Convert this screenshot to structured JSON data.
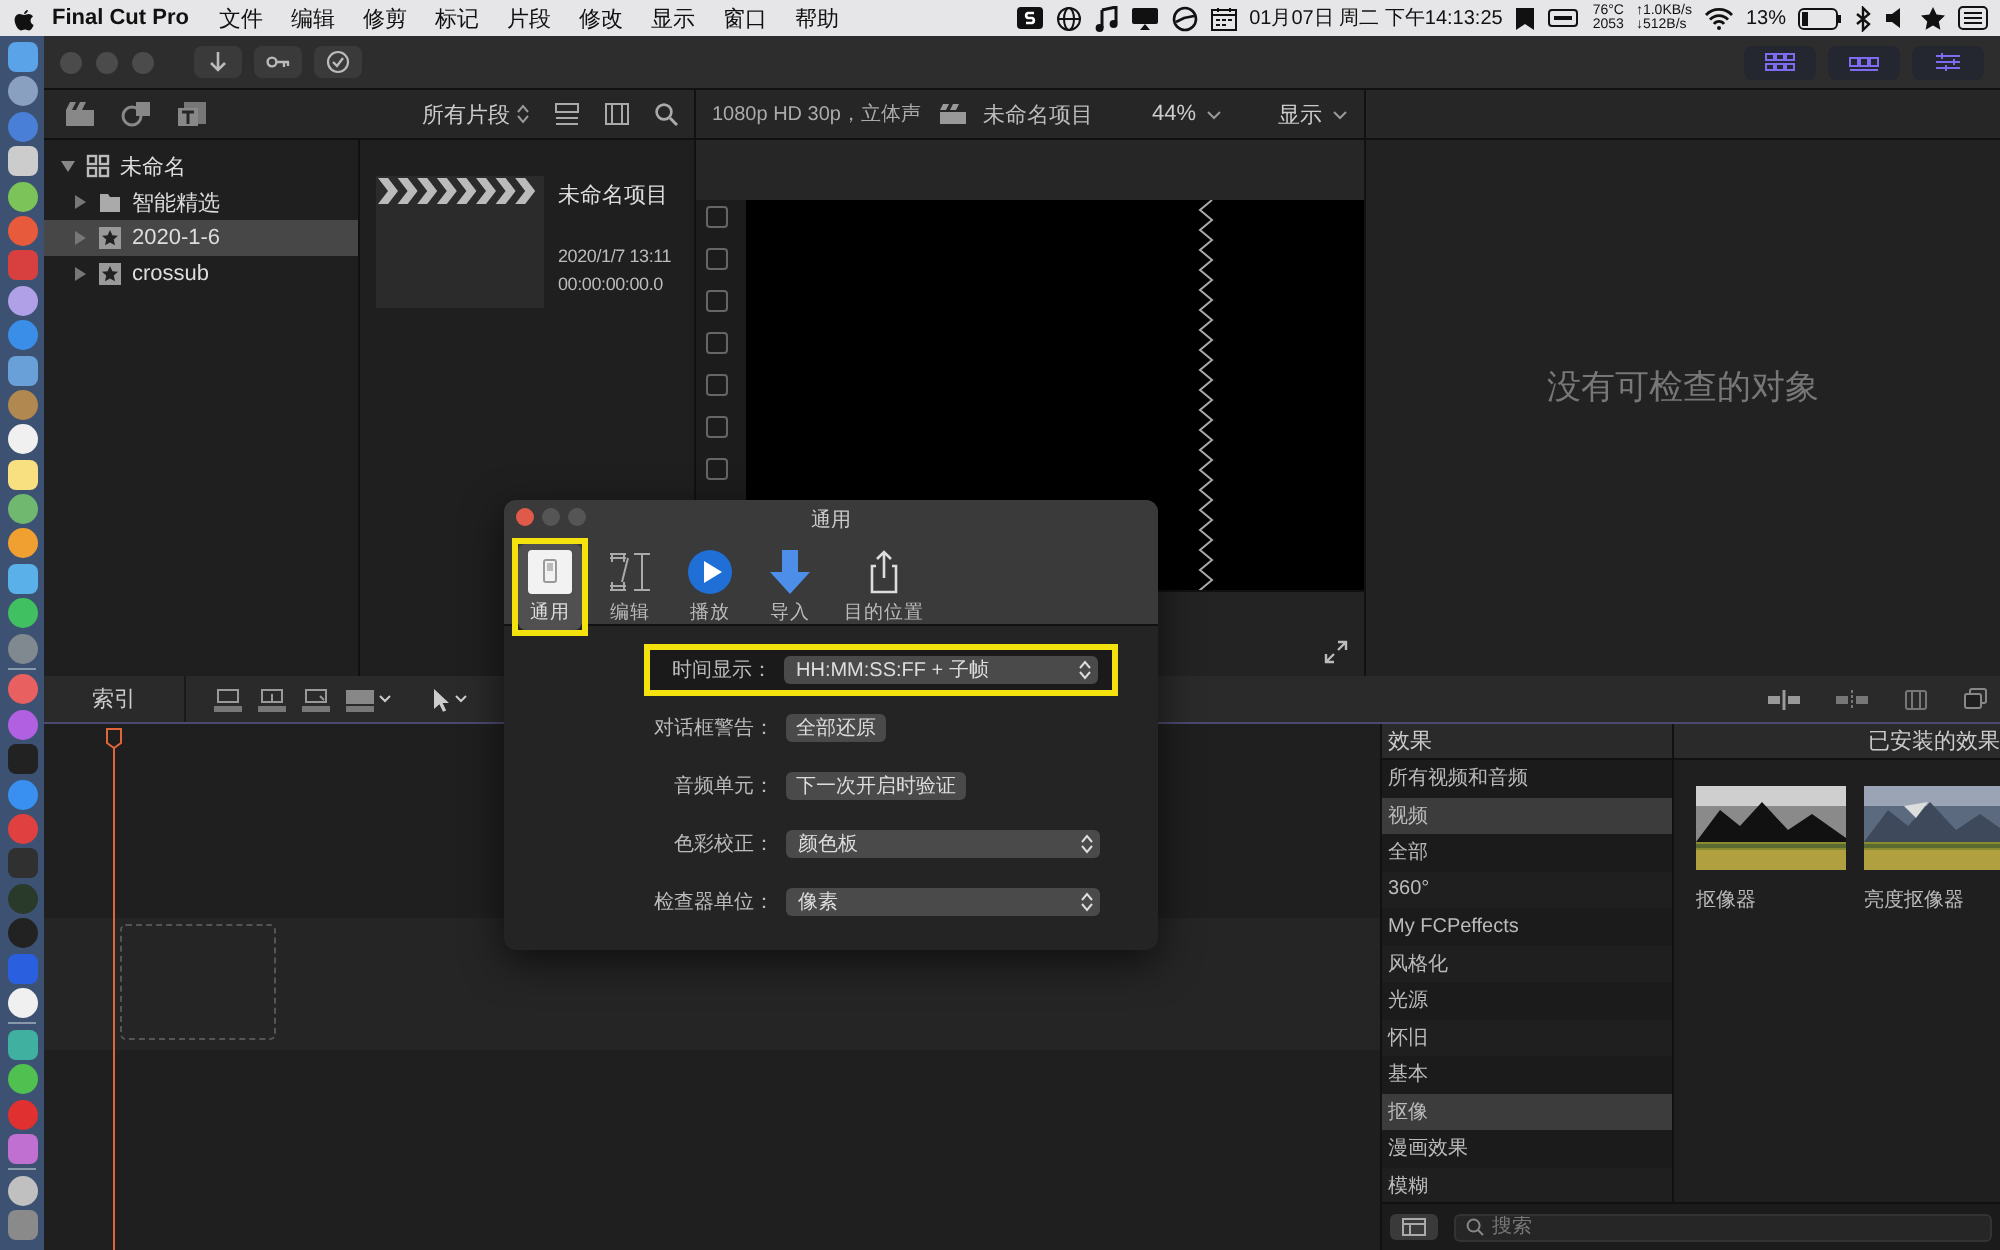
{
  "menu_bar": {
    "app": "Final Cut Pro",
    "menus": [
      "文件",
      "编辑",
      "修剪",
      "标记",
      "片段",
      "修改",
      "显示",
      "窗口",
      "帮助"
    ],
    "status": {
      "datetime": "01月07日 周二 下午14:13:25",
      "temperature": "76°C",
      "fan": "2053",
      "upload": "↑1.0KB/s",
      "download": "↓512B/s",
      "battery": "13%"
    }
  },
  "library": {
    "label": "未命名",
    "expanded": true,
    "children": [
      {
        "label": "智能精选",
        "kind": "folder",
        "expanded": false,
        "selected": false
      },
      {
        "label": "2020-1-6",
        "kind": "event",
        "expanded": false,
        "selected": true
      },
      {
        "label": "crossub",
        "kind": "event",
        "expanded": false,
        "selected": false
      }
    ]
  },
  "browser": {
    "filter": "所有片段",
    "clip": {
      "title": "未命名项目",
      "date": "2020/1/7 13:11",
      "duration": "00:00:00:00.0"
    }
  },
  "viewer": {
    "format": "1080p HD 30p，立体声",
    "project": "未命名项目",
    "zoom": "44%",
    "view_menu": "显示"
  },
  "inspector": {
    "message": "没有可检查的对象"
  },
  "timeline": {
    "index_button": "索引"
  },
  "effects": {
    "header": "效果",
    "categories": [
      {
        "label": "所有视频和音频",
        "selected": false
      },
      {
        "label": "视频",
        "selected": true
      },
      {
        "label": "全部",
        "selected": false
      },
      {
        "label": "360°",
        "selected": false
      },
      {
        "label": "My FCPeffects",
        "selected": false
      },
      {
        "label": "风格化",
        "selected": false
      },
      {
        "label": "光源",
        "selected": false
      },
      {
        "label": "怀旧",
        "selected": false
      },
      {
        "label": "基本",
        "selected": false
      },
      {
        "label": "抠像",
        "selected": true
      },
      {
        "label": "漫画效果",
        "selected": false
      },
      {
        "label": "模糊",
        "selected": false
      }
    ],
    "installed_title": "已安装的效果",
    "items": [
      {
        "label": "抠像器",
        "kind": "picture"
      },
      {
        "label": "亮度抠像器",
        "kind": "picture"
      }
    ],
    "search": {
      "placeholder": "搜索"
    }
  },
  "dialog": {
    "title": "通用",
    "tabs": [
      {
        "label": "通用",
        "kind": "general",
        "selected": true,
        "highlighted": true
      },
      {
        "label": "编辑",
        "kind": "editing",
        "selected": false,
        "highlighted": false
      },
      {
        "label": "播放",
        "kind": "playback",
        "selected": false,
        "highlighted": false
      },
      {
        "label": "导入",
        "kind": "import",
        "selected": false,
        "highlighted": false
      },
      {
        "label": "目的位置",
        "kind": "destinations",
        "selected": false,
        "highlighted": false
      }
    ],
    "rows": [
      {
        "label": "时间显示：",
        "kind": "popup",
        "value": "HH:MM:SS:FF + 子帧",
        "highlighted": true
      },
      {
        "label": "对话框警告：",
        "kind": "button",
        "value": "全部还原",
        "highlighted": false
      },
      {
        "label": "音频单元：",
        "kind": "button",
        "value": "下一次开启时验证",
        "highlighted": false
      },
      {
        "label": "色彩校正：",
        "kind": "popup",
        "value": "颜色板",
        "highlighted": false
      },
      {
        "label": "检查器单位：",
        "kind": "popup",
        "value": "像素",
        "highlighted": false
      }
    ]
  }
}
